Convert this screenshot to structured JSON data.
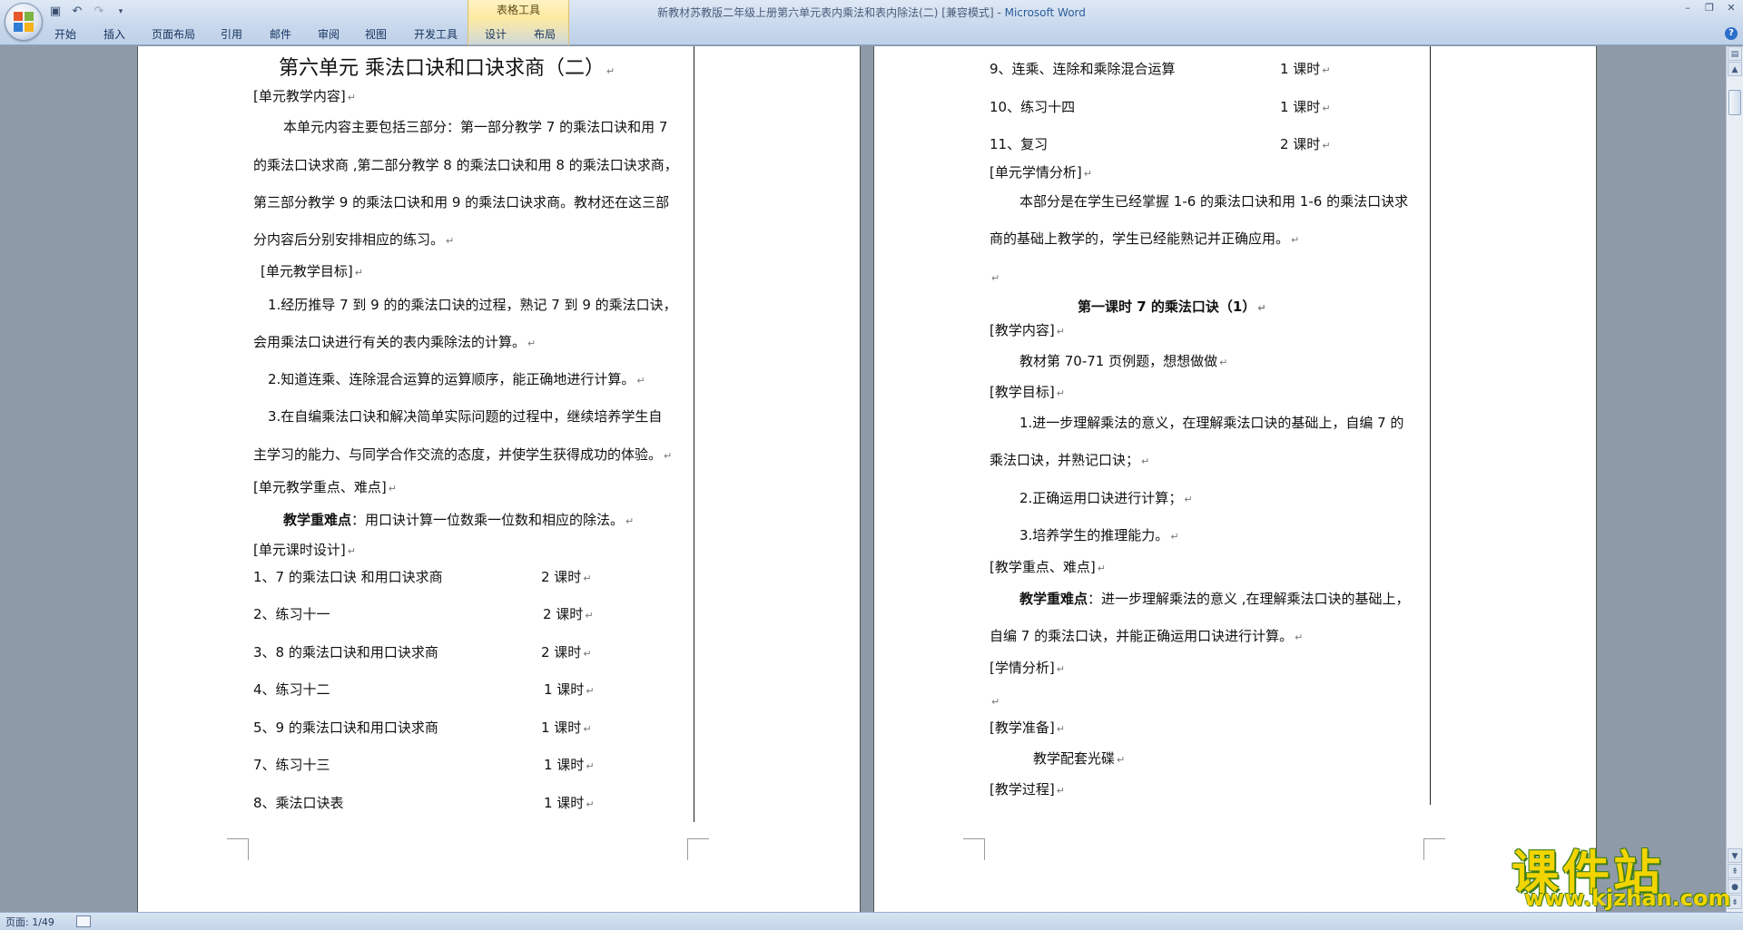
{
  "window": {
    "title": "新教材苏教版二年级上册第六单元表内乘法和表内除法(二) [兼容模式] - ",
    "app_name": "Microsoft Word",
    "contextual_group": "表格工具"
  },
  "tabs": [
    "开始",
    "插入",
    "页面布局",
    "引用",
    "邮件",
    "审阅",
    "视图",
    "开发工具",
    "设计",
    "布局"
  ],
  "status": {
    "page": "页面: 1/49"
  },
  "watermark": {
    "cn": "课件站",
    "url": "www.kjzhan.com"
  },
  "page1": {
    "title": "第六单元     乘法口诀和口诀求商（二）",
    "l1": "[单元教学内容]",
    "l2": "本单元内容主要包括三部分：第一部分教学 7 的乘法口诀和用 7",
    "l3": "的乘法口诀求商 ,第二部分教学 8 的乘法口诀和用 8 的乘法口诀求商，",
    "l4": "第三部分教学 9 的乘法口诀和用 9 的乘法口诀求商。教材还在这三部",
    "l5": "分内容后分别安排相应的练习。",
    "l6": "[单元教学目标]",
    "l7": "1.经历推导 7 到 9 的的乘法口诀的过程，熟记 7 到 9 的乘法口诀，",
    "l8": "会用乘法口诀进行有关的表内乘除法的计算。",
    "l9": "2.知道连乘、连除混合运算的运算顺序，能正确地进行计算。",
    "l10": "3.在自编乘法口诀和解决简单实际问题的过程中，继续培养学生自",
    "l11": "主学习的能力、与同学合作交流的态度，并使学生获得成功的体验。",
    "l12": "[单元教学重点、难点]",
    "l13_bold": "教学重难点",
    "l13": "：用口诀计算一位数乘一位数和相应的除法。",
    "l14": "[单元课时设计]",
    "schedule": [
      {
        "item": "1、7 的乘法口诀  和用口诀求商",
        "hours": "2 课时"
      },
      {
        "item": "2、练习十一",
        "hours": "2 课时"
      },
      {
        "item": "3、8 的乘法口诀和用口诀求商",
        "hours": "2 课时"
      },
      {
        "item": "4、练习十二",
        "hours": "1 课时"
      },
      {
        "item": "5、9 的乘法口诀和用口诀求商",
        "hours": "1 课时"
      },
      {
        "item": "7、练习十三",
        "hours": "1 课时"
      },
      {
        "item": "8、乘法口诀表",
        "hours": "1 课时"
      }
    ]
  },
  "page2": {
    "schedule": [
      {
        "item": "9、连乘、连除和乘除混合运算",
        "hours": "1 课时"
      },
      {
        "item": "10、练习十四",
        "hours": "1 课时"
      },
      {
        "item": "11、复习",
        "hours": "2 课时"
      }
    ],
    "l1": "[单元学情分析]",
    "l2": "本部分是在学生已经掌握 1-6 的乘法口诀和用 1-6 的乘法口诀求",
    "l3": "商的基础上教学的，学生已经能熟记并正确应用。",
    "lesson_title": "第一课时          7 的乘法口诀（1）",
    "l4": "[教学内容]",
    "l5": "教材第 70-71 页例题，想想做做",
    "l6": "[教学目标]",
    "l7": "1.进一步理解乘法的意义，在理解乘法口诀的基础上，自编 7 的",
    "l8": "乘法口诀，并熟记口诀；",
    "l9": "2.正确运用口诀进行计算；",
    "l10": "3.培养学生的推理能力。",
    "l11": "[教学重点、难点]",
    "l12_bold": "教学重难点",
    "l12": "：进一步理解乘法的意义 ,在理解乘法口诀的基础上，",
    "l13": "自编 7 的乘法口诀，并能正确运用口诀进行计算。",
    "l14": "[学情分析]",
    "l15": "[教学准备]",
    "l16": "教学配套光碟",
    "l17": "[教学过程]"
  }
}
